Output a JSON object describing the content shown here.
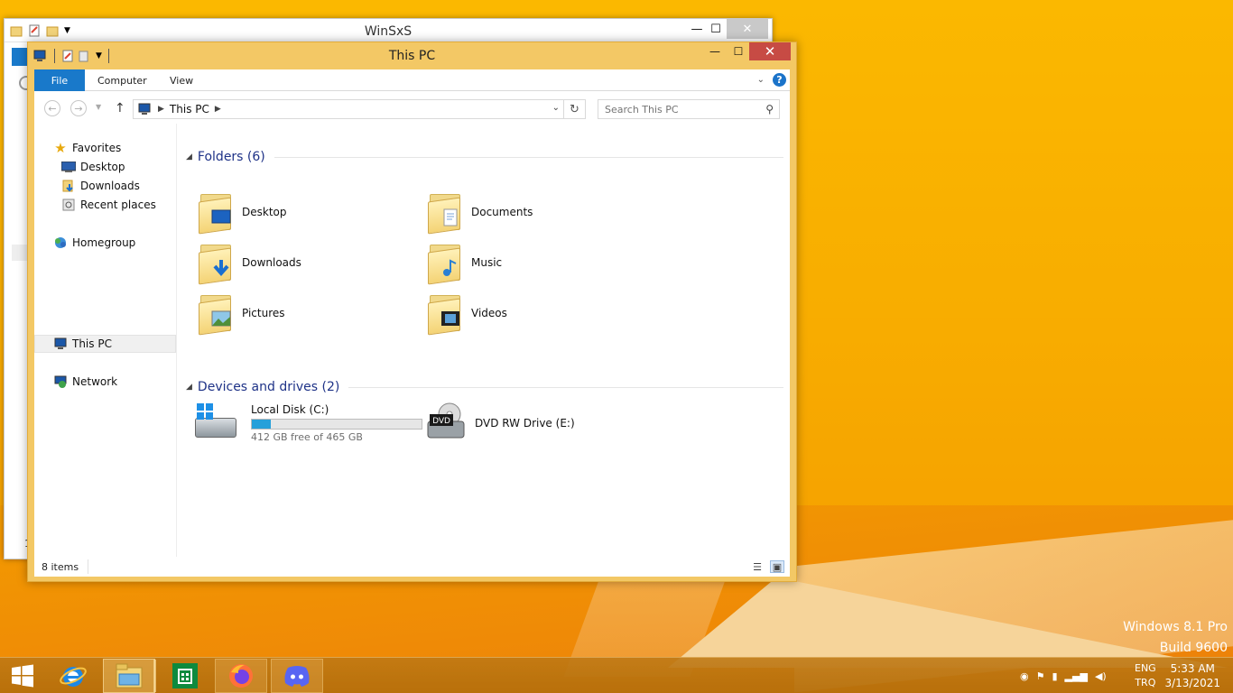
{
  "desktop": {
    "watermark_line1": "Windows 8.1 Pro",
    "watermark_line2": "Build 9600"
  },
  "back_window": {
    "title": "WinSxS",
    "status_partial": "1"
  },
  "window": {
    "title": "This PC",
    "controls": {
      "minimize": "—",
      "maximize": "☐",
      "close": "✕"
    },
    "ribbon": {
      "tabs": [
        {
          "label": "File"
        },
        {
          "label": "Computer"
        },
        {
          "label": "View"
        }
      ],
      "help": "?"
    },
    "address": {
      "segments": [
        "This PC"
      ],
      "search_placeholder": "Search This PC"
    },
    "sidebar": {
      "items": [
        {
          "label": "Favorites",
          "icon": "star-icon"
        },
        {
          "label": "Desktop",
          "icon": "desktop-icon"
        },
        {
          "label": "Downloads",
          "icon": "downloads-icon"
        },
        {
          "label": "Recent places",
          "icon": "recent-places-icon"
        },
        {
          "label": "Homegroup",
          "icon": "homegroup-icon"
        },
        {
          "label": "This PC",
          "icon": "computer-icon",
          "selected": true
        },
        {
          "label": "Network",
          "icon": "network-icon"
        }
      ]
    },
    "folders_group": {
      "header": "Folders (6)",
      "items": [
        {
          "label": "Desktop",
          "icon": "desktop-folder-icon"
        },
        {
          "label": "Documents",
          "icon": "documents-folder-icon"
        },
        {
          "label": "Downloads",
          "icon": "downloads-folder-icon"
        },
        {
          "label": "Music",
          "icon": "music-folder-icon"
        },
        {
          "label": "Pictures",
          "icon": "pictures-folder-icon"
        },
        {
          "label": "Videos",
          "icon": "videos-folder-icon"
        }
      ]
    },
    "drives_group": {
      "header": "Devices and drives (2)",
      "local_disk": {
        "name": "Local Disk (C:)",
        "free_text": "412 GB free of 465 GB",
        "used_fraction": 0.114
      },
      "dvd": {
        "name": "DVD RW Drive (E:)",
        "badge": "DVD"
      }
    },
    "status": {
      "items_count": "8 items"
    }
  },
  "taskbar": {
    "apps": [
      {
        "name": "start-button"
      },
      {
        "name": "internet-explorer"
      },
      {
        "name": "file-explorer",
        "active": true
      },
      {
        "name": "store"
      },
      {
        "name": "firefox"
      },
      {
        "name": "discord"
      }
    ],
    "lang_top": "ENG",
    "lang_bottom": "TRQ",
    "time": "5:33 AM",
    "date": "3/13/2021"
  },
  "colors": {
    "accent_blue": "#1979ca",
    "title_bar": "#f3c865",
    "close_red": "#c74b44",
    "header_text": "#1e3287",
    "usage_fill": "#26a0da"
  }
}
